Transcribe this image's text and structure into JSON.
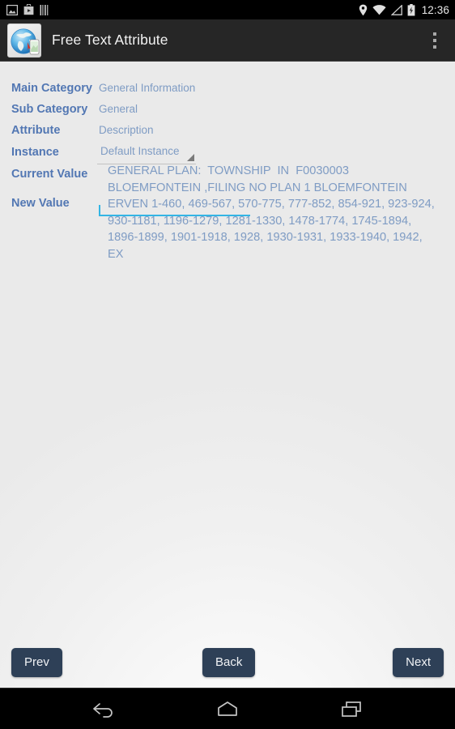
{
  "status_bar": {
    "time": "12:36",
    "left_icons": [
      "image-icon",
      "media-box-icon",
      "barcode-icon"
    ],
    "right_icons": [
      "location-pin-icon",
      "wifi-icon",
      "signal-icon",
      "battery-charging-icon"
    ]
  },
  "action_bar": {
    "app_icon": "globe-phone-app-icon",
    "title": "Free Text Attribute",
    "overflow_menu": "more-options-icon"
  },
  "form": {
    "rows": [
      {
        "label": "Main Category",
        "value": "General Information"
      },
      {
        "label": "Sub Category",
        "value": "General"
      },
      {
        "label": "Attribute",
        "value": "Description"
      }
    ],
    "instance": {
      "label": "Instance",
      "selected": "Default Instance",
      "caret": "dropdown-caret-icon"
    }
  },
  "value_section": {
    "current_label": "Current Value",
    "new_label": "New Value",
    "current_value": "GENERAL PLAN:  TOWNSHIP  IN  F0030003 BLOEMFONTEIN ,FILING NO PLAN 1 BLOEMFONTEIN ERVEN 1-460, 469-567, 570-775, 777-852, 854-921, 923-924, 930-1181, 1196-1279, 1281-1330, 1478-1774, 1745-1894, 1896-1899, 1901-1918, 1928, 1930-1931, 1933-1940, 1942,  EX",
    "new_value": "",
    "new_value_placeholder": ""
  },
  "buttons": {
    "prev": "Prev",
    "back": "Back",
    "next": "Next"
  },
  "nav_bar": {
    "back": "nav-back-icon",
    "home": "nav-home-icon",
    "recents": "nav-recents-icon"
  },
  "colors": {
    "label_blue": "#5277b3",
    "value_blue": "#7f9cc4",
    "button_navy": "#2e4057",
    "edit_underline": "#33b5e5",
    "action_bar": "#262626"
  }
}
